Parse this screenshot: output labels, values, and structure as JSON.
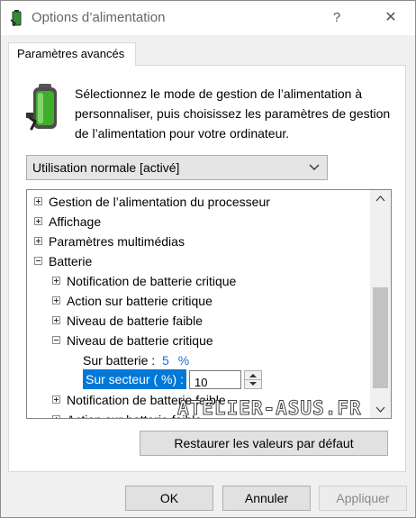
{
  "window": {
    "title": "Options d’alimentation",
    "help_label": "?",
    "close_label": "✕"
  },
  "tab": {
    "label": "Paramètres avancés"
  },
  "description": "Sélectionnez le mode de gestion de l’alimentation à personnaliser, puis choisissez les paramètres de gestion de l’alimentation pour votre ordinateur.",
  "plan_select": {
    "value": "Utilisation normale [activé]"
  },
  "tree": {
    "items": [
      {
        "label": "Gestion de l’alimentation du processeur",
        "state": "collapsed"
      },
      {
        "label": "Affichage",
        "state": "collapsed"
      },
      {
        "label": "Paramètres multimédias",
        "state": "collapsed"
      },
      {
        "label": "Batterie",
        "state": "expanded"
      },
      {
        "label": "Notification de batterie critique",
        "state": "collapsed"
      },
      {
        "label": "Action sur batterie critique",
        "state": "collapsed"
      },
      {
        "label": "Niveau de batterie faible",
        "state": "collapsed"
      },
      {
        "label": "Niveau de batterie critique",
        "state": "expanded"
      },
      {
        "label": "Notification de batterie faible",
        "state": "collapsed"
      },
      {
        "label": "Action sur batterie faible",
        "state": "collapsed"
      }
    ],
    "on_battery": {
      "label": "Sur batterie :",
      "value": "5",
      "unit": "%"
    },
    "plugged_in": {
      "label": "Sur secteur ( %) :",
      "value": "10"
    }
  },
  "watermark": "ATELIER-ASUS.FR",
  "buttons": {
    "restore": "Restaurer les valeurs par défaut",
    "ok": "OK",
    "cancel": "Annuler",
    "apply": "Appliquer"
  },
  "icons": {
    "title": "battery-plug-icon",
    "header": "battery-icon",
    "dropdown": "chevron-down-icon",
    "expand": "plus-box-icon",
    "collapse": "minus-box-icon"
  },
  "colors": {
    "selection": "#0078d7",
    "value_text": "#1a6fd1",
    "battery_green": "#3fae2a"
  }
}
